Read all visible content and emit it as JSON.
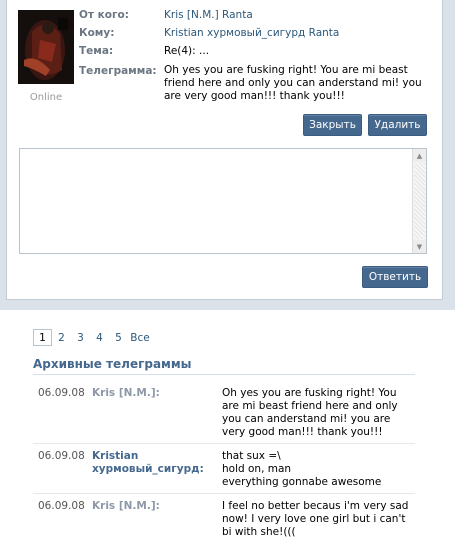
{
  "header": {
    "labels": {
      "from": "От кого:",
      "to": "Кому:",
      "subject": "Тема:",
      "message": "Телеграмма:"
    },
    "from": "Kris [N.M.] Ranta",
    "to": "Kristian хурмовый_сигурд Ranta",
    "subject": "Re(4): ...",
    "message": "Oh yes you are fusking right! You are mi beast friend here and only you can anderstand mi! you are very good man!!! thank you!!!",
    "status": "Online"
  },
  "actions": {
    "close": "Закрыть",
    "delete": "Удалить",
    "reply": "Ответить"
  },
  "reply": {
    "value": ""
  },
  "pager": {
    "pages": [
      "1",
      "2",
      "3",
      "4",
      "5"
    ],
    "all": "Все",
    "current": "1"
  },
  "archive": {
    "title": "Архивные телеграммы",
    "rows": [
      {
        "date": "06.09.08",
        "author": "Kris [N.M.]:",
        "text": "Oh yes you are fusking right! You are mi beast friend here and only you can anderstand mi! you are very good man!!! thank you!!!"
      },
      {
        "date": "06.09.08",
        "author": "Kristian хурмовый_сигурд:",
        "text_lines": [
          "that sux =\\",
          "hold on, man",
          "everything gonnabe awesome"
        ]
      },
      {
        "date": "06.09.08",
        "author": "Kris [N.M.]:",
        "text": "I feel no better becaus i'm very sad now! I very love one girl but i can't bi with she!((("
      }
    ]
  },
  "colors": {
    "accent": "#45688e",
    "link": "#2b587a",
    "frame": "#dae1e8"
  }
}
